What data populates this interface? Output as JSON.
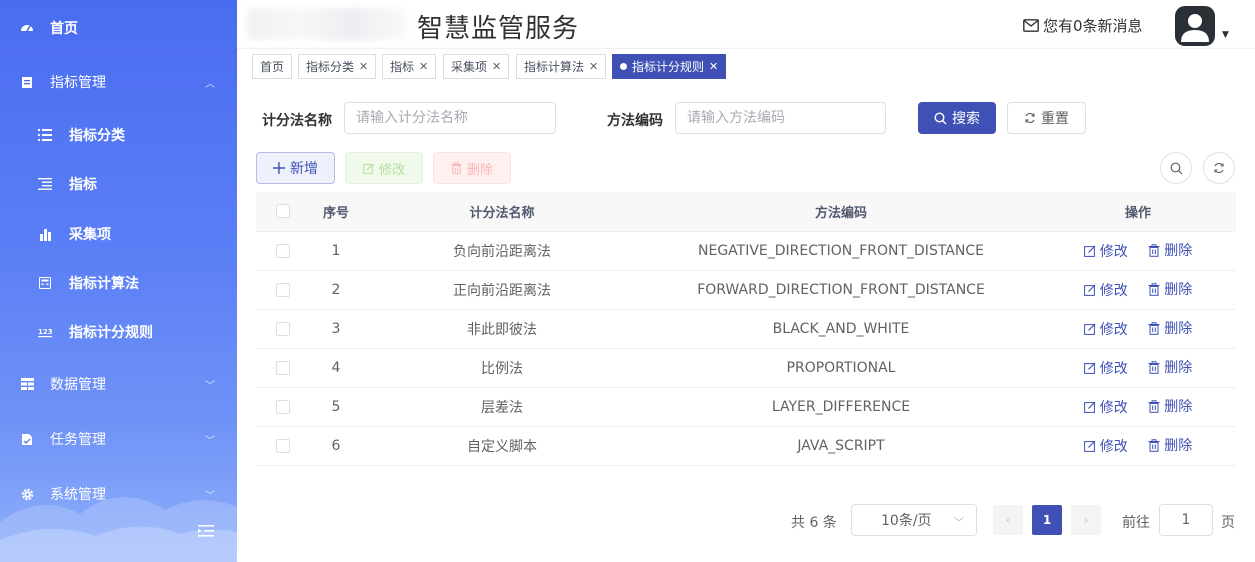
{
  "header": {
    "title": "智慧监管服务",
    "message": "您有0条新消息"
  },
  "sidebar": {
    "items": [
      {
        "label": "首页",
        "icon": "dashboard-icon",
        "level": 1
      },
      {
        "label": "指标管理",
        "icon": "clipboard-icon",
        "level": 1,
        "expanded": true
      },
      {
        "label": "指标分类",
        "icon": "list-icon",
        "level": 2
      },
      {
        "label": "指标",
        "icon": "indent-list-icon",
        "level": 2
      },
      {
        "label": "采集项",
        "icon": "bar-chart-icon",
        "level": 2
      },
      {
        "label": "指标计算法",
        "icon": "calculator-icon",
        "level": 2
      },
      {
        "label": "指标计分规则",
        "icon": "number-icon",
        "level": 2
      },
      {
        "label": "数据管理",
        "icon": "table-icon",
        "level": 1
      },
      {
        "label": "任务管理",
        "icon": "task-icon",
        "level": 1
      },
      {
        "label": "系统管理",
        "icon": "gear-icon",
        "level": 1
      }
    ]
  },
  "tabs": [
    {
      "label": "首页",
      "closable": false
    },
    {
      "label": "指标分类",
      "closable": true
    },
    {
      "label": "指标",
      "closable": true
    },
    {
      "label": "采集项",
      "closable": true
    },
    {
      "label": "指标计算法",
      "closable": true
    },
    {
      "label": "指标计分规则",
      "closable": true,
      "active": true
    }
  ],
  "filters": {
    "name_label": "计分法名称",
    "name_placeholder": "请输入计分法名称",
    "code_label": "方法编码",
    "code_placeholder": "请输入方法编码",
    "search_label": "搜索",
    "reset_label": "重置"
  },
  "toolbar": {
    "add_label": "新增",
    "edit_label": "修改",
    "delete_label": "删除"
  },
  "table": {
    "columns": [
      "序号",
      "计分法名称",
      "方法编码",
      "操作"
    ],
    "rows": [
      {
        "no": "1",
        "name": "负向前沿距离法",
        "code": "NEGATIVE_DIRECTION_FRONT_DISTANCE"
      },
      {
        "no": "2",
        "name": "正向前沿距离法",
        "code": "FORWARD_DIRECTION_FRONT_DISTANCE"
      },
      {
        "no": "3",
        "name": "非此即彼法",
        "code": "BLACK_AND_WHITE"
      },
      {
        "no": "4",
        "name": "比例法",
        "code": "PROPORTIONAL"
      },
      {
        "no": "5",
        "name": "层差法",
        "code": "LAYER_DIFFERENCE"
      },
      {
        "no": "6",
        "name": "自定义脚本",
        "code": "JAVA_SCRIPT"
      }
    ],
    "row_edit": "修改",
    "row_delete": "删除"
  },
  "pagination": {
    "total": "共 6 条",
    "page_size": "10条/页",
    "current": "1",
    "goto_label": "前往",
    "goto_value": "1",
    "page_suffix": "页"
  },
  "colors": {
    "primary": "#3f51b5",
    "sidebar_top": "#4a6cf0",
    "sidebar_bottom": "#8fb0fa"
  }
}
